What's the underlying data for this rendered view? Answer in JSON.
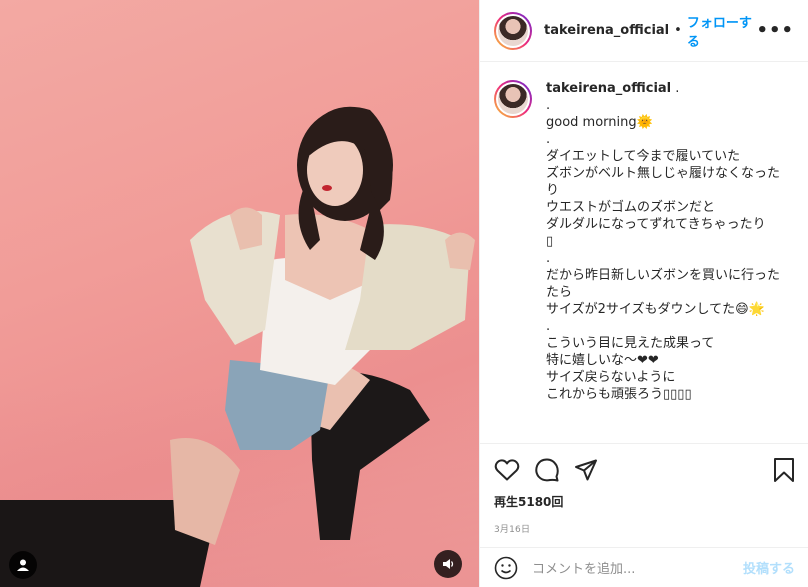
{
  "post": {
    "username": "takeirena_official",
    "follow_label": "フォローする",
    "separator": "•",
    "more_label": "•••"
  },
  "caption": {
    "username": "takeirena_official",
    "first_line_suffix": " .",
    "lines": [
      ".",
      "good morning🌞",
      ".",
      "ダイエットして今まで履いていた",
      "ズボンがベルト無しじゃ履けなくなった",
      "り",
      "ウエストがゴムのズボンだと",
      "ダルダルになってずれてきちゃったり",
      "▯",
      ".",
      "だから昨日新しいズボンを買いに行った",
      "たら",
      "サイズが2サイズもダウンしてた😄🌟",
      ".",
      "こういう目に見えた成果って",
      "特に嬉しいな〜❤❤",
      "サイズ戻らないように",
      "これからも頑張ろう▯▯▯▯"
    ]
  },
  "stats": {
    "views": "再生5180回",
    "date": "3月16日"
  },
  "comment": {
    "placeholder": "コメントを追加...",
    "post_label": "投稿する"
  },
  "icons": {
    "like": "heart-icon",
    "comment": "comment-icon",
    "share": "send-icon",
    "save": "bookmark-icon",
    "emoji": "emoji-icon",
    "user_tag": "user-tag-icon",
    "sound": "speaker-icon"
  },
  "colors": {
    "accent": "#0095f6",
    "post_disabled": "#b2dffc",
    "background_media": "#f19c98"
  }
}
